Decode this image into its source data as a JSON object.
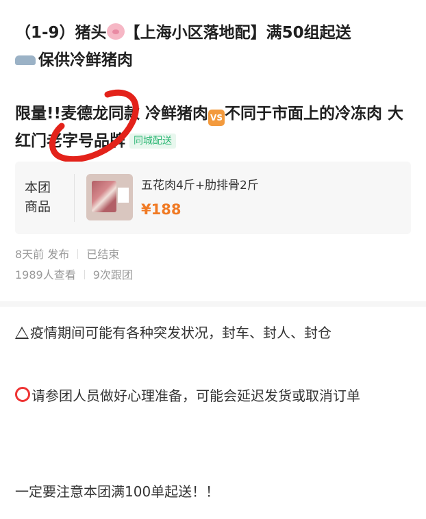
{
  "post": {
    "title_prefix": "（1-9）猪头",
    "title_mid": "【上海小区落地配】满50组起送",
    "title_line2": "保供冷鲜猪肉",
    "headline_part1": "限量!!麦德龙同款 冷鲜猪肉",
    "vs_badge": "VS",
    "headline_part2": "不同于市面上的冷冻肉 大红门老字号品牌",
    "tag": "同城配送"
  },
  "product": {
    "section_label": "本团商品",
    "name": "五花肉4斤+肋排骨2斤",
    "price": "¥188"
  },
  "meta": {
    "posted": "8天前 发布",
    "status": "已结束",
    "views": "1989人查看",
    "joins": "9次跟团"
  },
  "notes": {
    "line1": "疫情期间可能有各种突发状况，封车、封人、封仓",
    "line2": "请参团人员做好心理准备，可能会延迟发货或取消订单",
    "line3": "一定要注意本团满100单起送！！"
  },
  "colors": {
    "price": "#f07a24",
    "tag_text": "#2bb673",
    "annotation": "#e3221a"
  },
  "icons": [
    "pig-icon",
    "car-icon",
    "vs-icon",
    "warning-icon",
    "red-circle-icon"
  ]
}
